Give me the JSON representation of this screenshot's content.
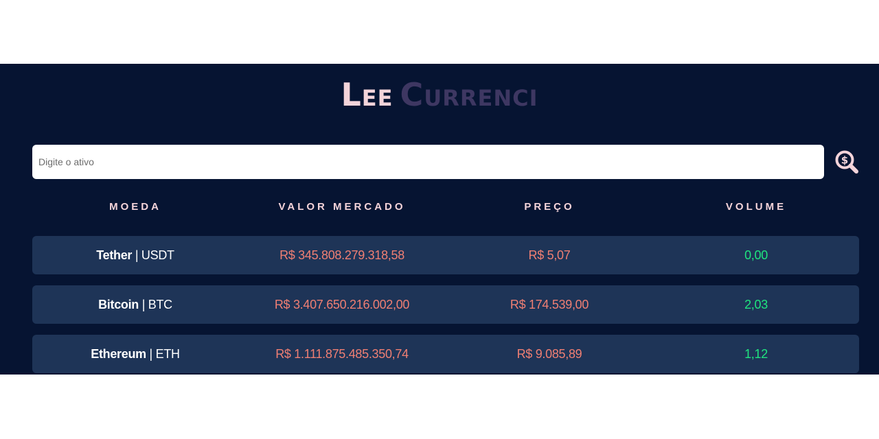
{
  "header": {
    "logo_part1": "Lee",
    "logo_part2": "Currenci",
    "colors": {
      "logo_light": "#f4d4da",
      "logo_dark": "#3e3762",
      "background": "#061432"
    }
  },
  "search": {
    "placeholder": "Digite o ativo",
    "value": "",
    "button_icon": "search-dollar-icon"
  },
  "table": {
    "headers": [
      "MOEDA",
      "VALOR MERCADO",
      "PREÇO",
      "VOLUME"
    ],
    "rows": [
      {
        "name": "Tether",
        "separator": " | ",
        "symbol": "USDT",
        "market_value": "R$ 345.808.279.318,58",
        "price": "R$ 5,07",
        "volume": "0,00"
      },
      {
        "name": "Bitcoin",
        "separator": " | ",
        "symbol": "BTC",
        "market_value": "R$ 3.407.650.216.002,00",
        "price": "R$ 174.539,00",
        "volume": "2,03"
      },
      {
        "name": "Ethereum",
        "separator": " | ",
        "symbol": "ETH",
        "market_value": "R$ 1.111.875.485.350,74",
        "price": "R$ 9.085,89",
        "volume": "1,12"
      }
    ],
    "colors": {
      "row_bg": "#1e3457",
      "value_text": "#f07f73",
      "volume_text": "#1fe57f",
      "header_text": "#f4d4da"
    }
  }
}
